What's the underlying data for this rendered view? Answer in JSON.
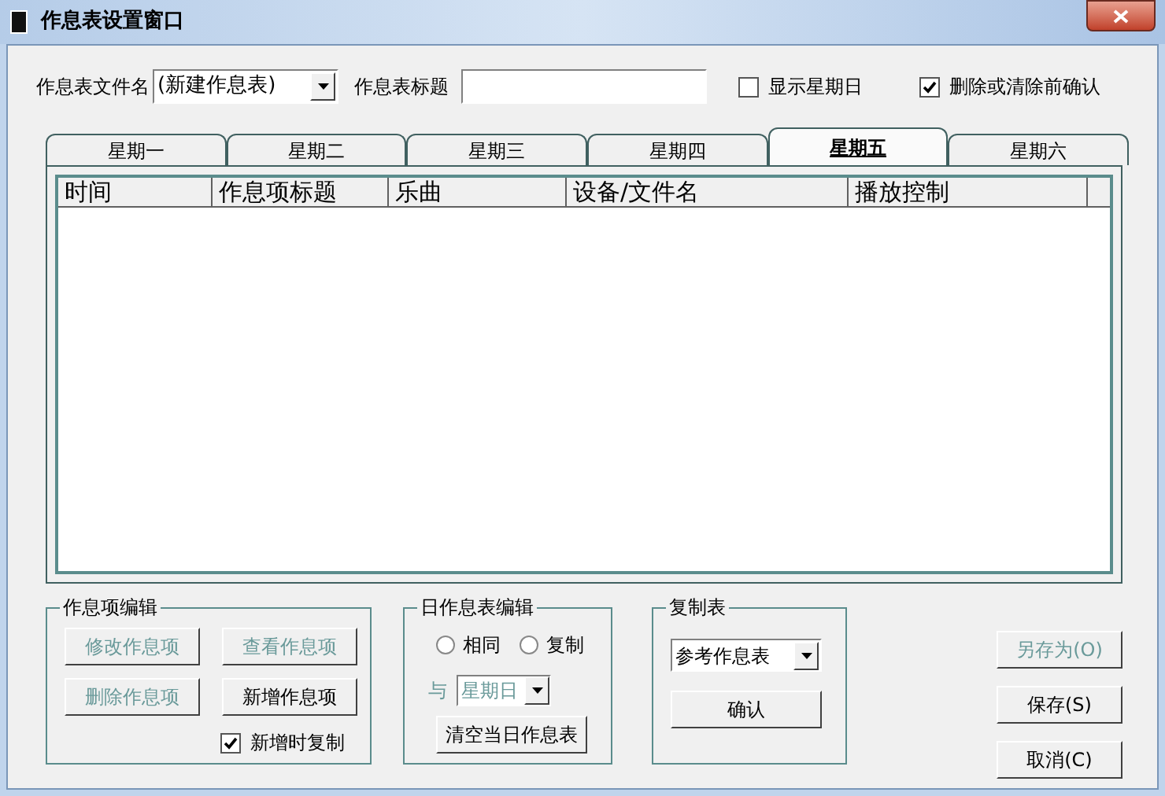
{
  "window": {
    "title": "作息表设置窗口"
  },
  "file_name": {
    "label": "作息表文件名",
    "value": "(新建作息表)"
  },
  "title_field": {
    "label": "作息表标题"
  },
  "options": [
    {
      "label": "显示星期日",
      "checked": false
    },
    {
      "label": "删除或清除前确认",
      "checked": true
    }
  ],
  "tabs": [
    {
      "label": "星期一",
      "selected": false
    },
    {
      "label": "星期二",
      "selected": false
    },
    {
      "label": "星期三",
      "selected": false
    },
    {
      "label": "星期四",
      "selected": false
    },
    {
      "label": "星期五",
      "selected": true
    },
    {
      "label": "星期六",
      "selected": false
    }
  ],
  "table": {
    "columns": [
      "时间",
      "作息项标题",
      "乐曲",
      "设备/文件名",
      "播放控制"
    ]
  },
  "item_edit": {
    "title": "作息项编辑",
    "buttons": [
      {
        "label": "修改作息项",
        "disabled": true
      },
      {
        "label": "查看作息项",
        "disabled": true
      },
      {
        "label": "删除作息项",
        "disabled": true
      },
      {
        "label": "新增作息项",
        "disabled": false
      }
    ],
    "copy_on_add": {
      "label": "新增时复制",
      "checked": true
    }
  },
  "day_edit": {
    "title": "日作息表编辑",
    "radios": [
      {
        "label": "相同",
        "selected": false
      },
      {
        "label": "复制",
        "selected": false
      }
    ],
    "with_label": "与",
    "with_value": "星期日",
    "with_disabled": true,
    "clear_button": "清空当日作息表"
  },
  "copy_table": {
    "title": "复制表",
    "select": "参考作息表",
    "confirm": "确认"
  },
  "actions": [
    {
      "label": "另存为(O)",
      "disabled": true
    },
    {
      "label": "保存(S)",
      "disabled": false
    },
    {
      "label": "取消(C)",
      "disabled": false
    }
  ]
}
